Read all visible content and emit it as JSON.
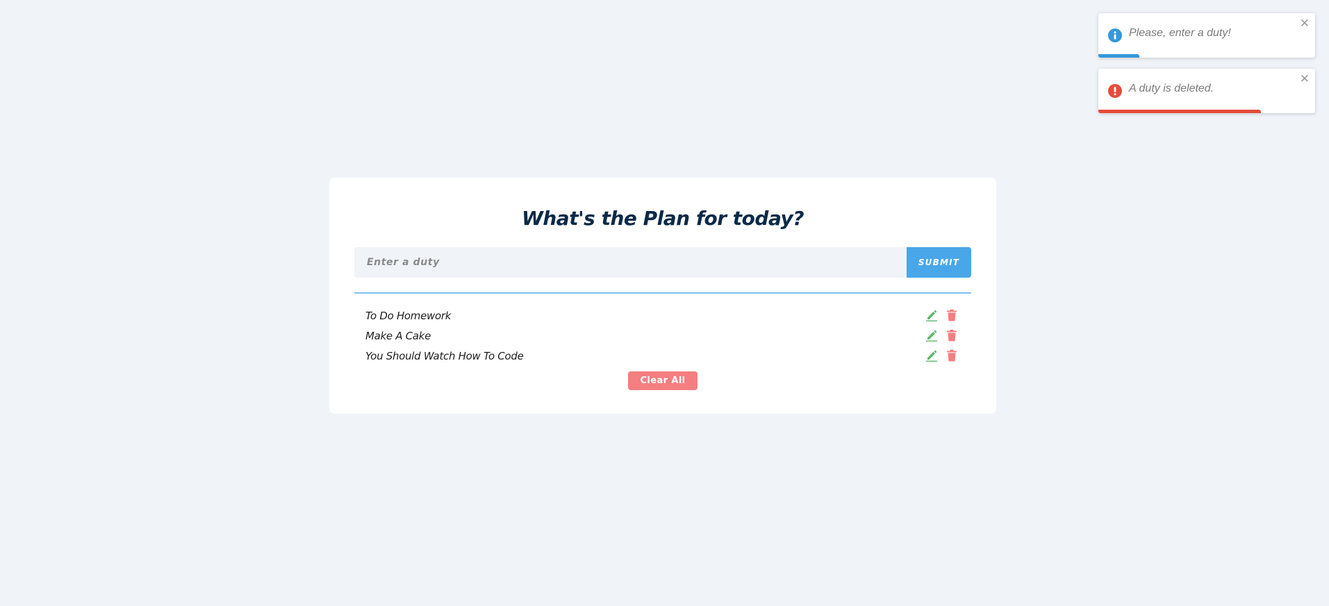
{
  "toasts": [
    {
      "message": "Please, enter a duty!",
      "icon": "info-icon",
      "type": "info",
      "color": "#3498db",
      "progress": 0.19,
      "close_label": "✕"
    },
    {
      "message": "A duty is deleted.",
      "icon": "error-icon",
      "type": "error",
      "color": "#e74c3c",
      "progress": 0.75,
      "close_label": "✕"
    }
  ],
  "app": {
    "title": "What's the Plan for today?",
    "input": {
      "placeholder": "Enter a duty",
      "value": ""
    },
    "submit_label": "SUBMIT",
    "items": [
      {
        "text": "To Do Homework"
      },
      {
        "text": "Make A Cake"
      },
      {
        "text": "You Should Watch How To Code"
      }
    ],
    "item_icons": {
      "edit": "edit-icon",
      "delete": "trash-icon"
    },
    "clear_label": "Clear All"
  },
  "colors": {
    "background": "#f0f4f8",
    "accent": "#49a6e9",
    "title": "#0b2a48",
    "edit": "#5fb86b",
    "delete": "#f47e80"
  }
}
